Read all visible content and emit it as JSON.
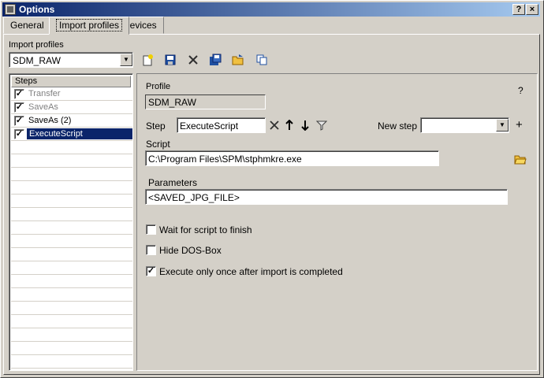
{
  "window": {
    "title": "Options",
    "help_btn": "?",
    "close_btn": "×"
  },
  "tabs": [
    {
      "label": "General"
    },
    {
      "label": "Import profiles"
    },
    {
      "label": "Devices"
    }
  ],
  "import_profiles": {
    "label": "Import profiles",
    "selected": "SDM_RAW"
  },
  "toolbar": [
    {
      "icon": "new-profile-icon"
    },
    {
      "icon": "save-icon"
    },
    {
      "icon": "delete-icon"
    },
    {
      "icon": "save-as-icon"
    },
    {
      "icon": "open-folder-icon"
    },
    {
      "icon": "copy-icon"
    }
  ],
  "steps": {
    "header": "Steps",
    "items": [
      {
        "label": "Transfer",
        "checked": true,
        "enabled": false,
        "selected": false
      },
      {
        "label": "SaveAs",
        "checked": true,
        "enabled": false,
        "selected": false
      },
      {
        "label": "SaveAs (2)",
        "checked": true,
        "enabled": true,
        "selected": false
      },
      {
        "label": "ExecuteScript",
        "checked": true,
        "enabled": true,
        "selected": true
      }
    ]
  },
  "detail": {
    "profile_label": "Profile",
    "profile_value": "SDM_RAW",
    "help": "?",
    "step_label": "Step",
    "step_value": "ExecuteScript",
    "new_step_label": "New step",
    "new_step_value": "",
    "add": "+",
    "script_label": "Script",
    "script_value": "C:\\Program Files\\SPM\\stphmkre.exe",
    "parameters_label": "Parameters",
    "parameters_value": "<SAVED_JPG_FILE>",
    "options": [
      {
        "label": "Wait for script to finish",
        "checked": false
      },
      {
        "label": "Hide DOS-Box",
        "checked": false
      },
      {
        "label": "Execute only once after import is completed",
        "checked": true
      }
    ]
  },
  "colors": {
    "title_start": "#0a246a",
    "title_end": "#a6caf0",
    "selection": "#0a246a",
    "face": "#d4d0c8"
  }
}
